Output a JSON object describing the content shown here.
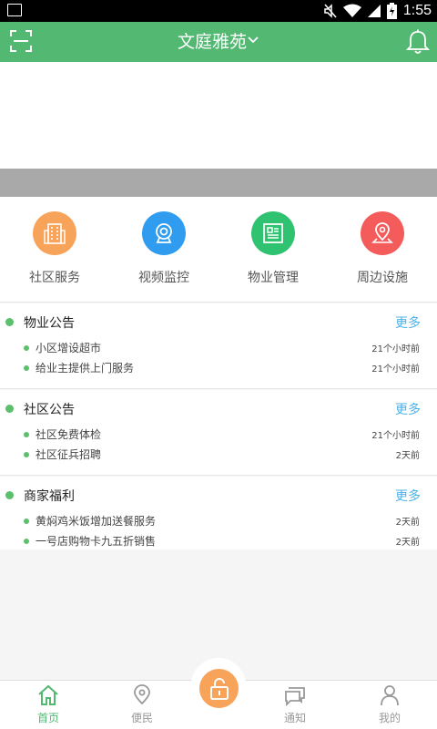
{
  "status_bar": {
    "time": "1:55"
  },
  "header": {
    "title": "文庭雅苑",
    "scan_icon": "scan-icon",
    "bell_icon": "bell-icon",
    "background": "#52b872"
  },
  "quick_actions": [
    {
      "label": "社区服务",
      "icon": "building-icon",
      "color": "#f8a35a"
    },
    {
      "label": "视频监控",
      "icon": "webcam-icon",
      "color": "#2f9cf0"
    },
    {
      "label": "物业管理",
      "icon": "document-icon",
      "color": "#2fc270"
    },
    {
      "label": "周边设施",
      "icon": "location-pin-icon",
      "color": "#f45b5b"
    }
  ],
  "sections": [
    {
      "title": "物业公告",
      "more": "更多",
      "items": [
        {
          "text": "小区增设超市",
          "time": "21个小时前"
        },
        {
          "text": "给业主提供上门服务",
          "time": "21个小时前"
        }
      ]
    },
    {
      "title": "社区公告",
      "more": "更多",
      "items": [
        {
          "text": "社区免费体检",
          "time": "21个小时前"
        },
        {
          "text": "社区征兵招聘",
          "time": "2天前"
        }
      ]
    },
    {
      "title": "商家福利",
      "more": "更多",
      "items": [
        {
          "text": "黄焖鸡米饭增加送餐服务",
          "time": "2天前"
        },
        {
          "text": "一号店购物卡九五折销售",
          "time": "2天前"
        }
      ]
    }
  ],
  "bottom_nav": [
    {
      "label": "首页",
      "icon": "home-icon",
      "active": true
    },
    {
      "label": "便民",
      "icon": "map-pin-icon",
      "active": false
    },
    {
      "label": "",
      "icon": "unlock-icon",
      "active": false
    },
    {
      "label": "通知",
      "icon": "chat-icon",
      "active": false
    },
    {
      "label": "我的",
      "icon": "person-icon",
      "active": false
    }
  ],
  "colors": {
    "accent": "#52b872",
    "more_link": "#4cb2ea"
  }
}
